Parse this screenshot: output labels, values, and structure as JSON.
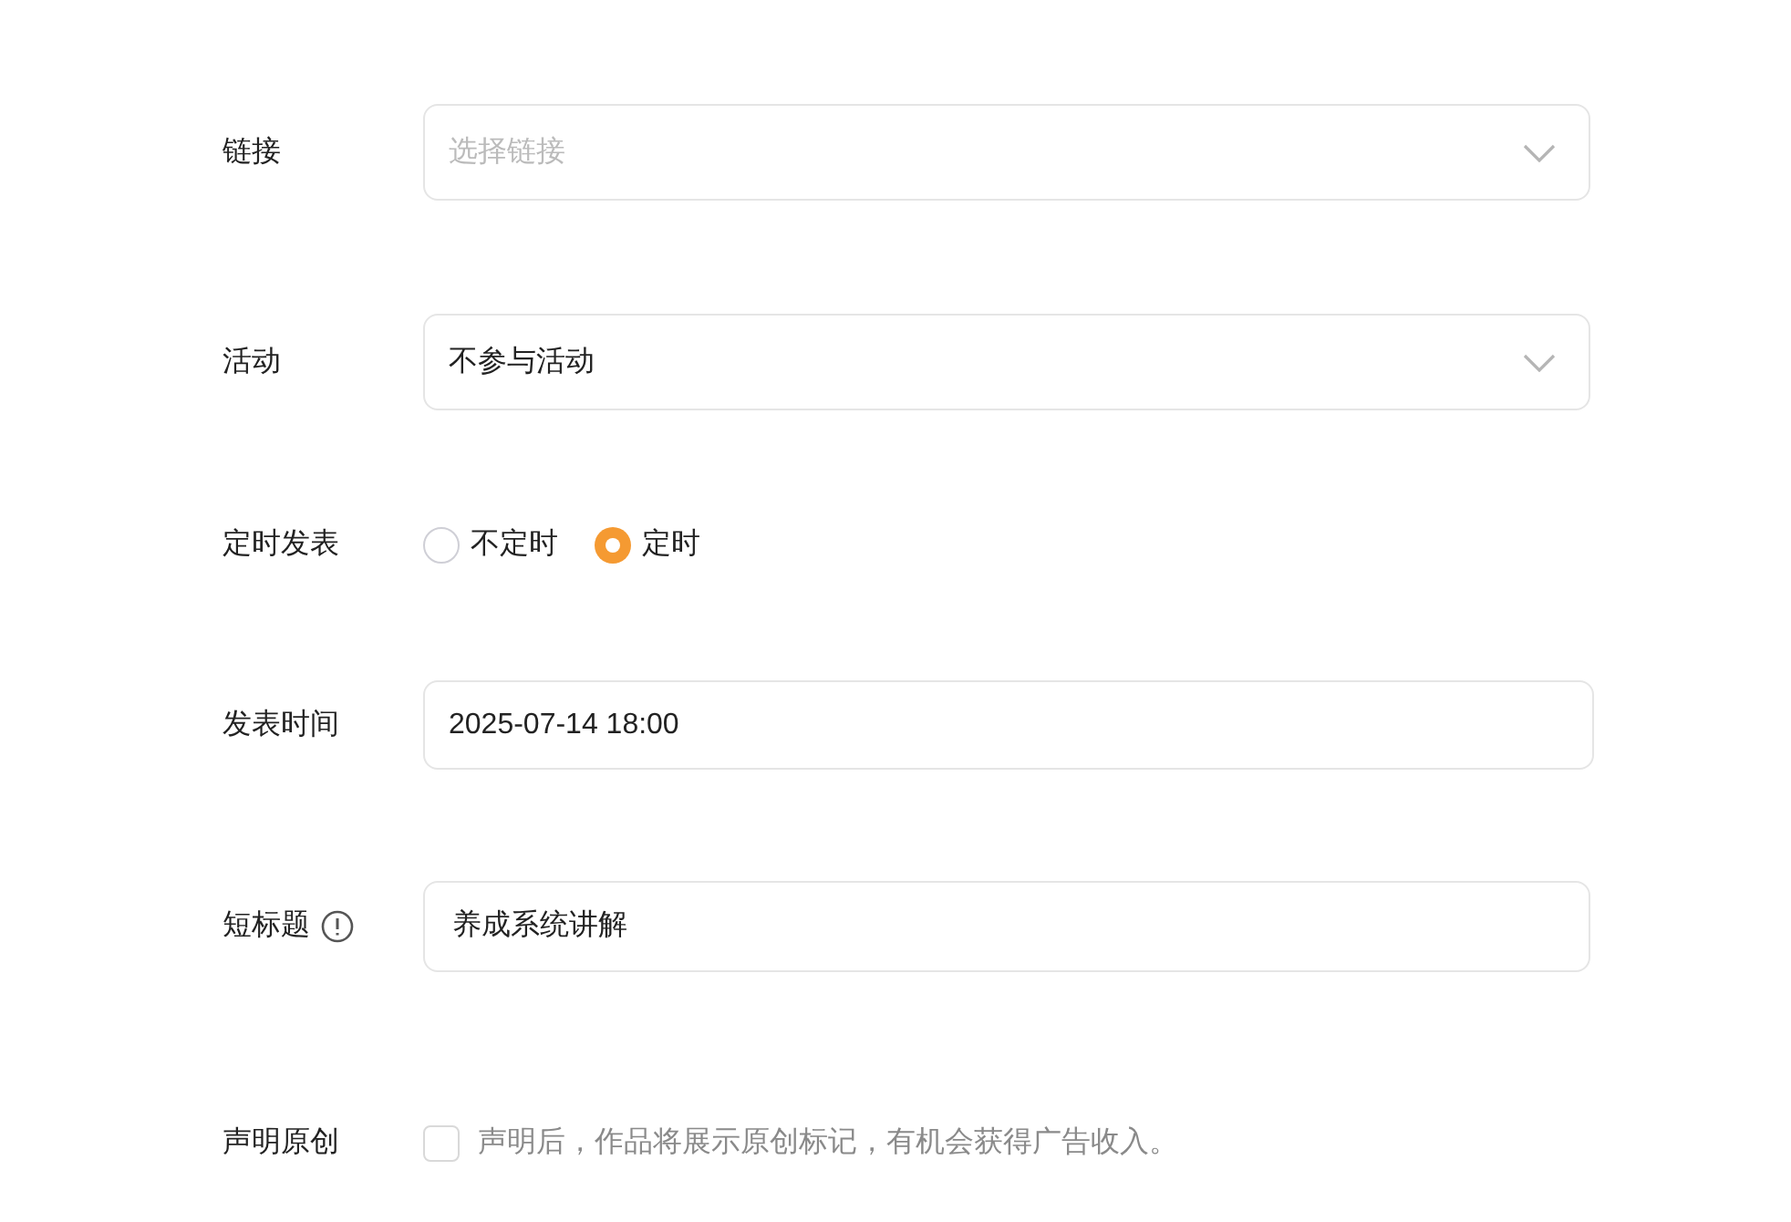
{
  "form": {
    "rows": [
      {
        "kind": "select",
        "label": "链接",
        "placeholder": "选择链接"
      },
      {
        "kind": "select",
        "label": "活动",
        "value": "不参与活动"
      },
      {
        "kind": "radio",
        "label": "定时发表",
        "options": [
          {
            "label": "不定时",
            "selected": false
          },
          {
            "label": "定时",
            "selected": true
          }
        ]
      },
      {
        "kind": "input",
        "label": "发表时间",
        "value": "2025-07-14 18:00"
      },
      {
        "kind": "input",
        "label": "短标题",
        "info": true,
        "value": "养成系统讲解"
      },
      {
        "kind": "checkbox",
        "label": "声明原创",
        "checked": false,
        "text": "声明后，作品将展示原创标记，有机会获得广告收入。"
      }
    ]
  }
}
